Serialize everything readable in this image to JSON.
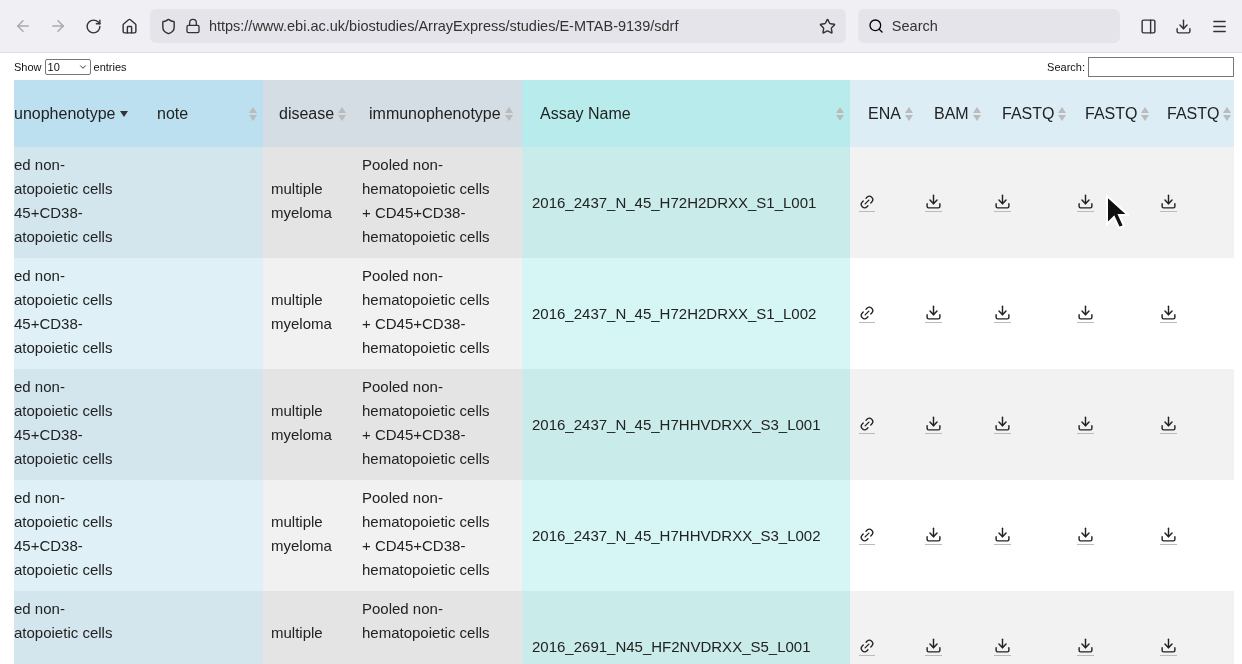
{
  "toolbar": {
    "url": "https://www.ebi.ac.uk/biostudies/ArrayExpress/studies/E-MTAB-9139/sdrf",
    "search_placeholder": "Search"
  },
  "table_controls": {
    "show_label": "Show",
    "page_size": "10",
    "entries_label": "entries",
    "search_label": "Search:"
  },
  "table": {
    "columns": [
      {
        "label": "unophenotype",
        "kind": "phenotype",
        "sorted": true
      },
      {
        "label": "note",
        "kind": "note",
        "sorted": false
      },
      {
        "label": "disease",
        "kind": "disease",
        "sorted": false
      },
      {
        "label": "immunophenotype",
        "kind": "immunophenotype",
        "sorted": false
      },
      {
        "label": "Assay Name",
        "kind": "assay",
        "sorted": false
      },
      {
        "label": "ENA",
        "kind": "link",
        "sorted": false
      },
      {
        "label": "BAM",
        "kind": "download",
        "sorted": false
      },
      {
        "label": "FASTQ",
        "kind": "download",
        "sorted": false
      },
      {
        "label": "FASTQ",
        "kind": "download",
        "sorted": false
      },
      {
        "label": "FASTQ",
        "kind": "download",
        "sorted": false
      }
    ],
    "rows": [
      {
        "phenotype": [
          "ed non-",
          "atopoietic cells",
          "45+CD38-",
          "atopoietic cells"
        ],
        "disease": [
          "multiple",
          "myeloma"
        ],
        "immunophenotype": [
          "Pooled non-",
          "hematopoietic cells",
          "+ CD45+CD38-",
          "hematopoietic cells"
        ],
        "assay_name": "2016_2437_N_45_H72H2DRXX_S1_L001"
      },
      {
        "phenotype": [
          "ed non-",
          "atopoietic cells",
          "45+CD38-",
          "atopoietic cells"
        ],
        "disease": [
          "multiple",
          "myeloma"
        ],
        "immunophenotype": [
          "Pooled non-",
          "hematopoietic cells",
          "+ CD45+CD38-",
          "hematopoietic cells"
        ],
        "assay_name": "2016_2437_N_45_H72H2DRXX_S1_L002"
      },
      {
        "phenotype": [
          "ed non-",
          "atopoietic cells",
          "45+CD38-",
          "atopoietic cells"
        ],
        "disease": [
          "multiple",
          "myeloma"
        ],
        "immunophenotype": [
          "Pooled non-",
          "hematopoietic cells",
          "+ CD45+CD38-",
          "hematopoietic cells"
        ],
        "assay_name": "2016_2437_N_45_H7HHVDRXX_S3_L001"
      },
      {
        "phenotype": [
          "ed non-",
          "atopoietic cells",
          "45+CD38-",
          "atopoietic cells"
        ],
        "disease": [
          "multiple",
          "myeloma"
        ],
        "immunophenotype": [
          "Pooled non-",
          "hematopoietic cells",
          "+ CD45+CD38-",
          "hematopoietic cells"
        ],
        "assay_name": "2016_2437_N_45_H7HHVDRXX_S3_L002"
      },
      {
        "phenotype": [
          "ed non-",
          "atopoietic cells"
        ],
        "disease": [
          "multiple"
        ],
        "immunophenotype": [
          "Pooled non-",
          "hematopoietic cells"
        ],
        "assay_name": "2016_2691_N45_HF2NVDRXX_S5_L001"
      }
    ]
  }
}
